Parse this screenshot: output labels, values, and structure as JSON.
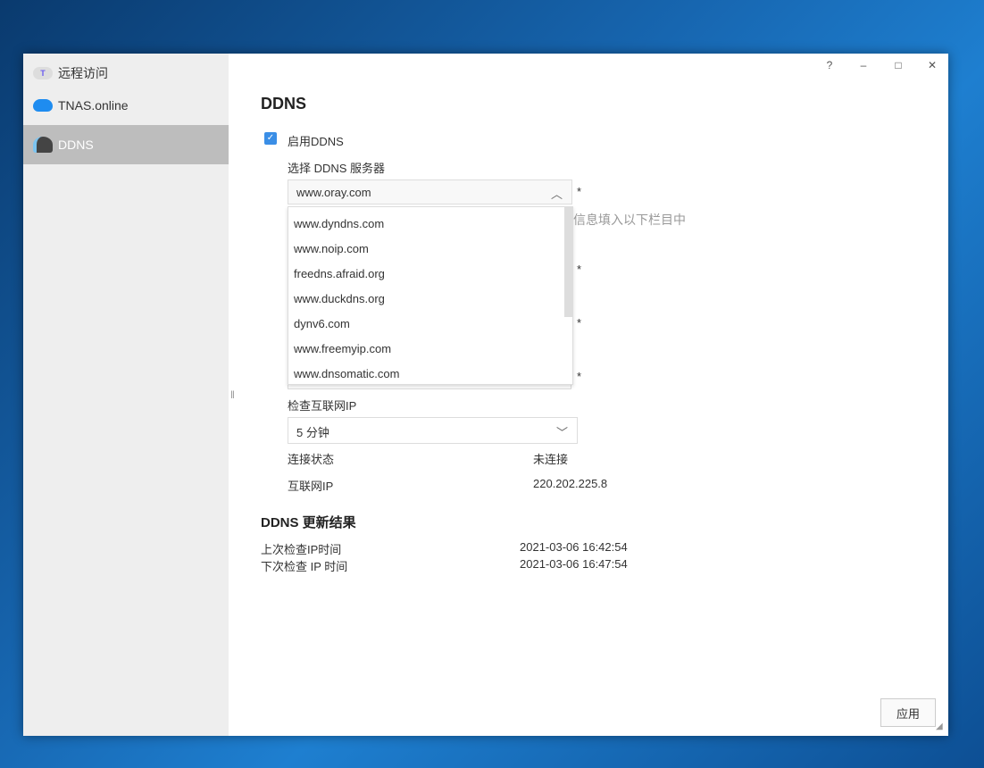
{
  "sidebar": {
    "items": [
      {
        "label": "远程访问",
        "icon": "remote-access-icon"
      },
      {
        "label": "TNAS.online",
        "icon": "cloud-icon"
      },
      {
        "label": "DDNS",
        "icon": "ddns-icon",
        "selected": true
      }
    ]
  },
  "window_controls": {
    "help": "?",
    "minimize": "–",
    "maximize": "□",
    "close": "✕"
  },
  "ddns": {
    "title": "DDNS",
    "enable_label": "启用DDNS",
    "enabled": true,
    "server_label": "选择 DDNS 服务器",
    "server_value": "www.oray.com",
    "hint_partial": "信息填入以下栏目中",
    "required": "*",
    "server_options": [
      "www.dyndns.com",
      "www.noip.com",
      "freedns.afraid.org",
      "www.duckdns.org",
      "dynv6.com",
      "www.freemyip.com",
      "www.dnsomatic.com"
    ],
    "check_ip_label": "检查互联网IP",
    "check_ip_value": "5 分钟",
    "status_label": "连接状态",
    "status_value": "未连接",
    "ip_label": "互联网IP",
    "ip_value": "220.202.225.8"
  },
  "results": {
    "title": "DDNS 更新结果",
    "last_label": "上次检查IP时间",
    "last_value": "2021-03-06 16:42:54",
    "next_label": "下次检查 IP 时间",
    "next_value": "2021-03-06 16:47:54"
  },
  "apply_label": "应用",
  "colors": {
    "accent": "#3a8ee6",
    "selected": "#bdbdbd"
  }
}
